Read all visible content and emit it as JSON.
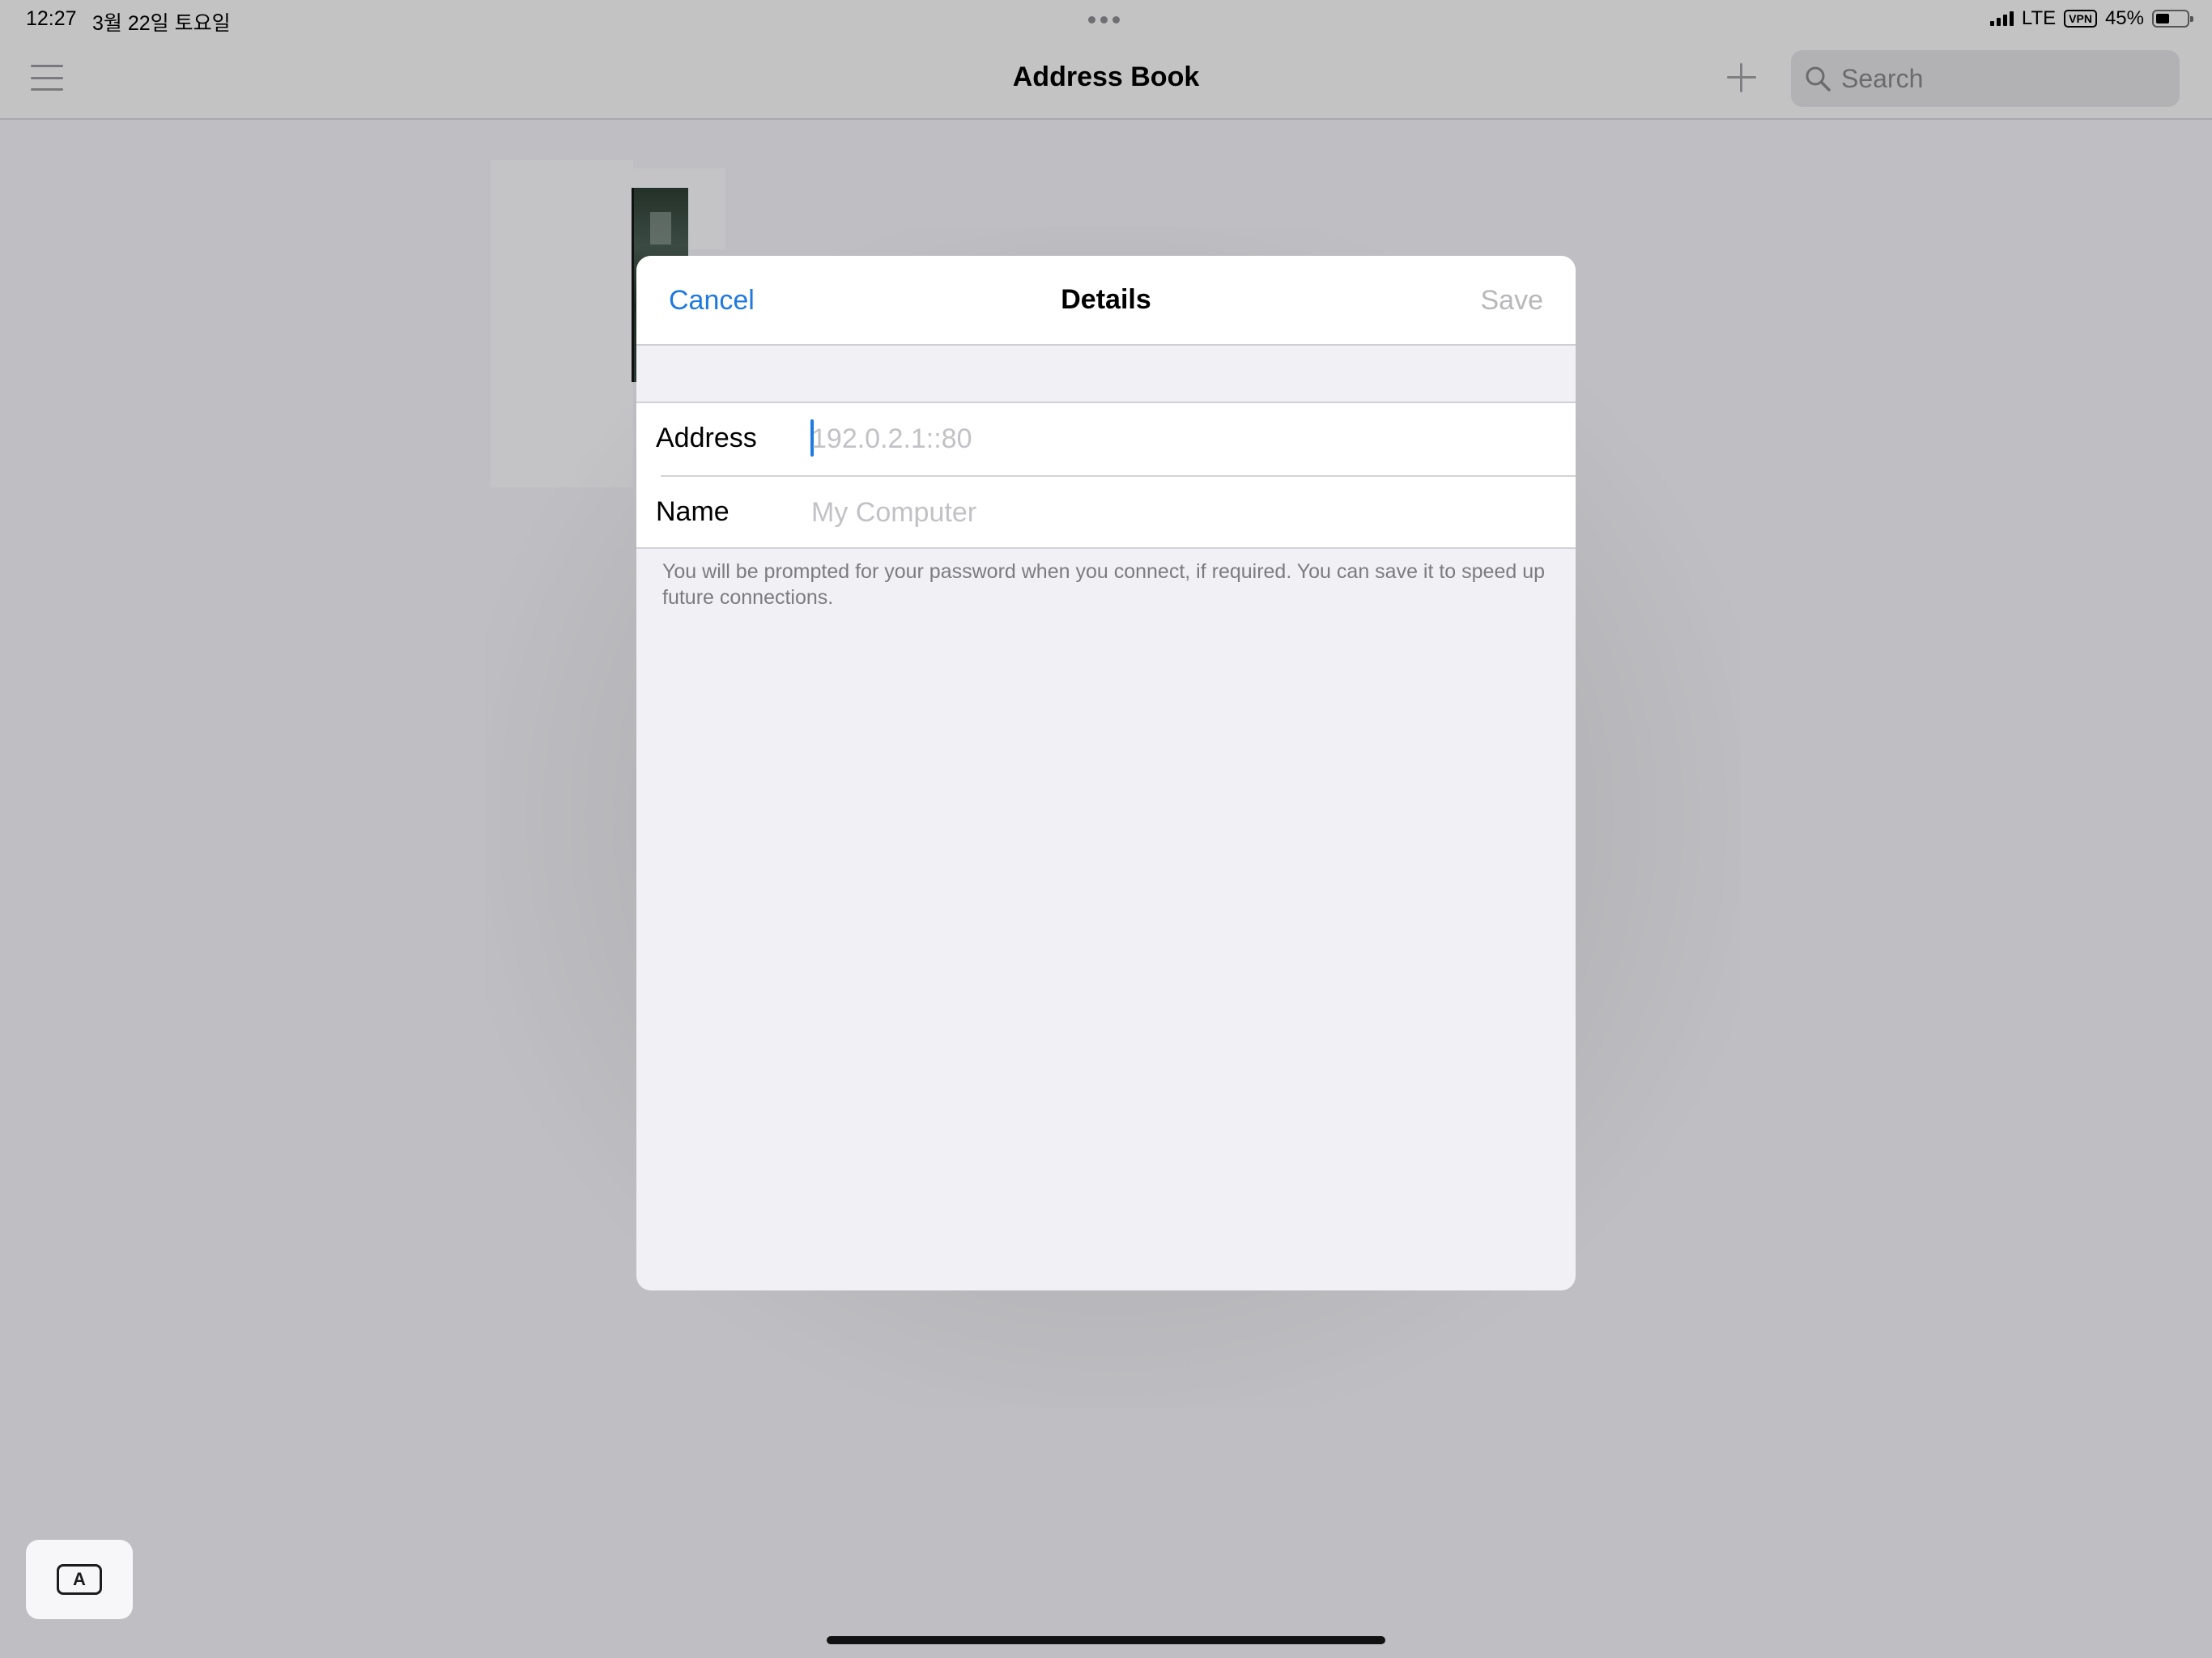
{
  "status_bar": {
    "time": "12:27",
    "date": "3월 22일 토요일",
    "network": "LTE",
    "vpn": "VPN",
    "battery": "45%",
    "battery_level": 0.45
  },
  "nav": {
    "title": "Address Book",
    "search_placeholder": "Search"
  },
  "dialog": {
    "cancel_label": "Cancel",
    "title": "Details",
    "save_label": "Save",
    "fields": [
      {
        "label": "Address",
        "placeholder": "192.0.2.1::80",
        "value": ""
      },
      {
        "label": "Name",
        "placeholder": "My Computer",
        "value": ""
      }
    ],
    "footnote": "You will be prompted for your password when you connect, if required. You can save it to speed up future connections."
  },
  "keyboard_button": {
    "label": "A"
  },
  "colors": {
    "accent": "#1f7ae0",
    "disabled": "#b8b8bb",
    "dimmed_background": "#bfbfc3"
  }
}
